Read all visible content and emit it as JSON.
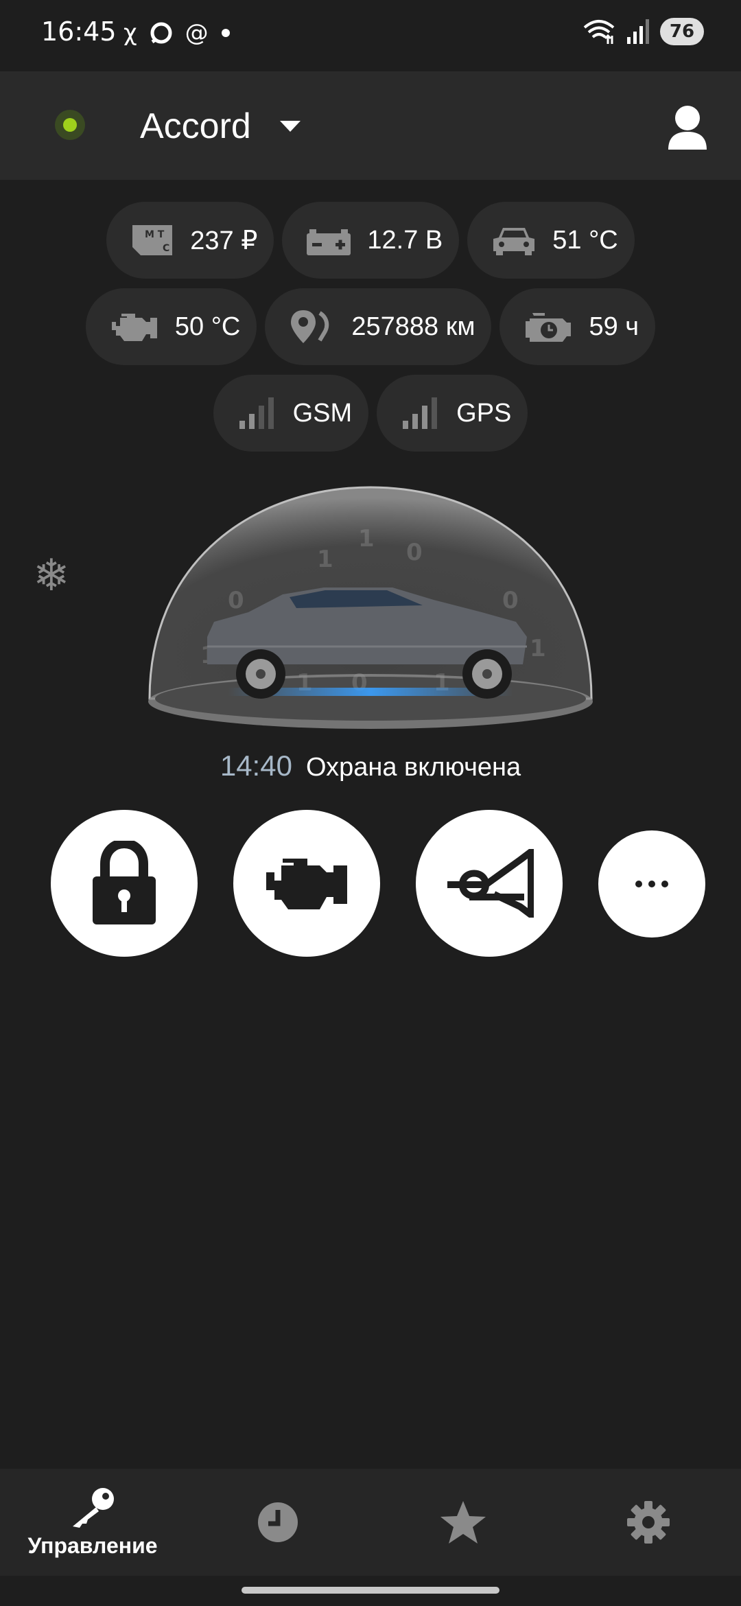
{
  "status_bar": {
    "time": "16:45",
    "battery": "76",
    "left_icons": [
      "x-icon",
      "chat-icon",
      "at-icon",
      "dot-icon"
    ],
    "right_icons": [
      "wifi-icon",
      "signal-icon"
    ]
  },
  "header": {
    "car_name": "Accord",
    "online_color": "#9fd01c"
  },
  "chips": {
    "balance": "237 ₽",
    "voltage": "12.7 В",
    "cabin_temp": "51 °C",
    "engine_temp": "50 °C",
    "mileage": "257888 км",
    "engine_hours": "59 ч",
    "gsm": "GSM",
    "gps": "GPS"
  },
  "security": {
    "time": "14:40",
    "status": "Охрана включена"
  },
  "actions": [
    {
      "icon": "lock-icon"
    },
    {
      "icon": "engine-icon"
    },
    {
      "icon": "horn-icon"
    },
    {
      "icon": "more-icon"
    }
  ],
  "bottom_nav": {
    "control_label": "Управление",
    "items": [
      "key-icon",
      "history-icon",
      "favorites-icon",
      "settings-icon"
    ]
  }
}
